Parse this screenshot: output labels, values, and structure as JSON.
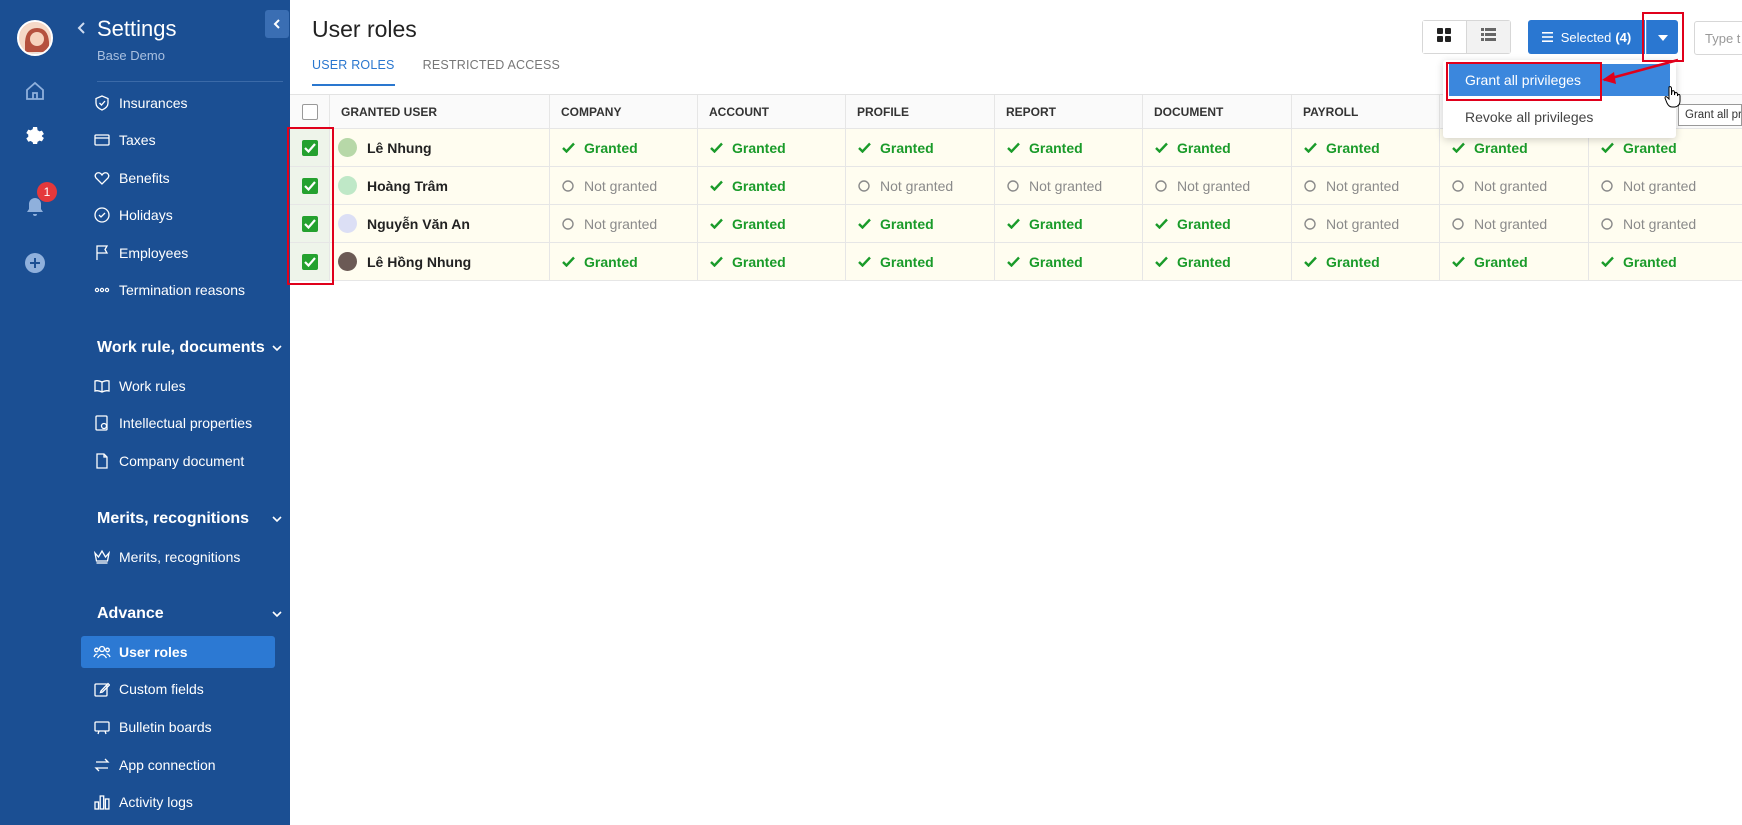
{
  "sidebar": {
    "title": "Settings",
    "subtitle": "Base Demo",
    "items_top": [
      {
        "label": "Insurances",
        "icon": "shield-icon"
      },
      {
        "label": "Taxes",
        "icon": "card-icon"
      },
      {
        "label": "Benefits",
        "icon": "heart-icon"
      },
      {
        "label": "Holidays",
        "icon": "check-circle-icon"
      },
      {
        "label": "Employees",
        "icon": "flag-icon"
      },
      {
        "label": "Termination reasons",
        "icon": "dots-icon"
      }
    ],
    "section_work": "Work rule, documents",
    "items_work": [
      {
        "label": "Work rules",
        "icon": "book-icon"
      },
      {
        "label": "Intellectual properties",
        "icon": "doc-icon"
      },
      {
        "label": "Company document",
        "icon": "file-icon"
      }
    ],
    "section_merits": "Merits, recognitions",
    "items_merits": [
      {
        "label": "Merits, recognitions",
        "icon": "crown-icon"
      }
    ],
    "section_advance": "Advance",
    "items_advance": [
      {
        "label": "User roles",
        "icon": "users-icon",
        "active": true
      },
      {
        "label": "Custom fields",
        "icon": "edit-icon"
      },
      {
        "label": "Bulletin boards",
        "icon": "board-icon"
      },
      {
        "label": "App connection",
        "icon": "swap-icon"
      },
      {
        "label": "Activity logs",
        "icon": "bar-chart-icon"
      }
    ]
  },
  "rail": {
    "notification_count": "1"
  },
  "main": {
    "title": "User roles",
    "tabs": [
      {
        "label": "USER ROLES",
        "active": true
      },
      {
        "label": "RESTRICTED ACCESS",
        "active": false
      }
    ],
    "selected_label": "Selected",
    "selected_count": "(4)",
    "search_placeholder": "Type t",
    "dropdown": {
      "grant": "Grant all privileges",
      "revoke": "Revoke all privileges"
    },
    "tooltip": "Grant all pr"
  },
  "table": {
    "columns": [
      "GRANTED USER",
      "COMPANY",
      "ACCOUNT",
      "PROFILE",
      "REPORT",
      "DOCUMENT",
      "PAYROLL"
    ],
    "rows": [
      {
        "name": "Lê Nhung",
        "avatar_color": "#b7d8a8",
        "checked": true,
        "perms": [
          "Granted",
          "Granted",
          "Granted",
          "Granted",
          "Granted",
          "Granted",
          "Granted",
          "Granted"
        ]
      },
      {
        "name": "Hoàng Trâm",
        "avatar_color": "#bfe8c7",
        "checked": true,
        "perms": [
          "Not granted",
          "Granted",
          "Not granted",
          "Not granted",
          "Not granted",
          "Not granted",
          "Not granted",
          "Not granted"
        ]
      },
      {
        "name": "Nguyễn Văn An",
        "avatar_color": "#dcdff5",
        "checked": true,
        "perms": [
          "Not granted",
          "Granted",
          "Granted",
          "Granted",
          "Granted",
          "Not granted",
          "Not granted",
          "Not granted"
        ]
      },
      {
        "name": "Lê Hồng Nhung",
        "avatar_color": "#6b5a55",
        "checked": true,
        "perms": [
          "Granted",
          "Granted",
          "Granted",
          "Granted",
          "Granted",
          "Granted",
          "Granted",
          "Granted"
        ]
      }
    ]
  },
  "colors": {
    "sidebar_bg": "#1b4f93",
    "accent": "#2a77d1",
    "granted": "#1a9b2a",
    "annotation_red": "#e0001b"
  }
}
